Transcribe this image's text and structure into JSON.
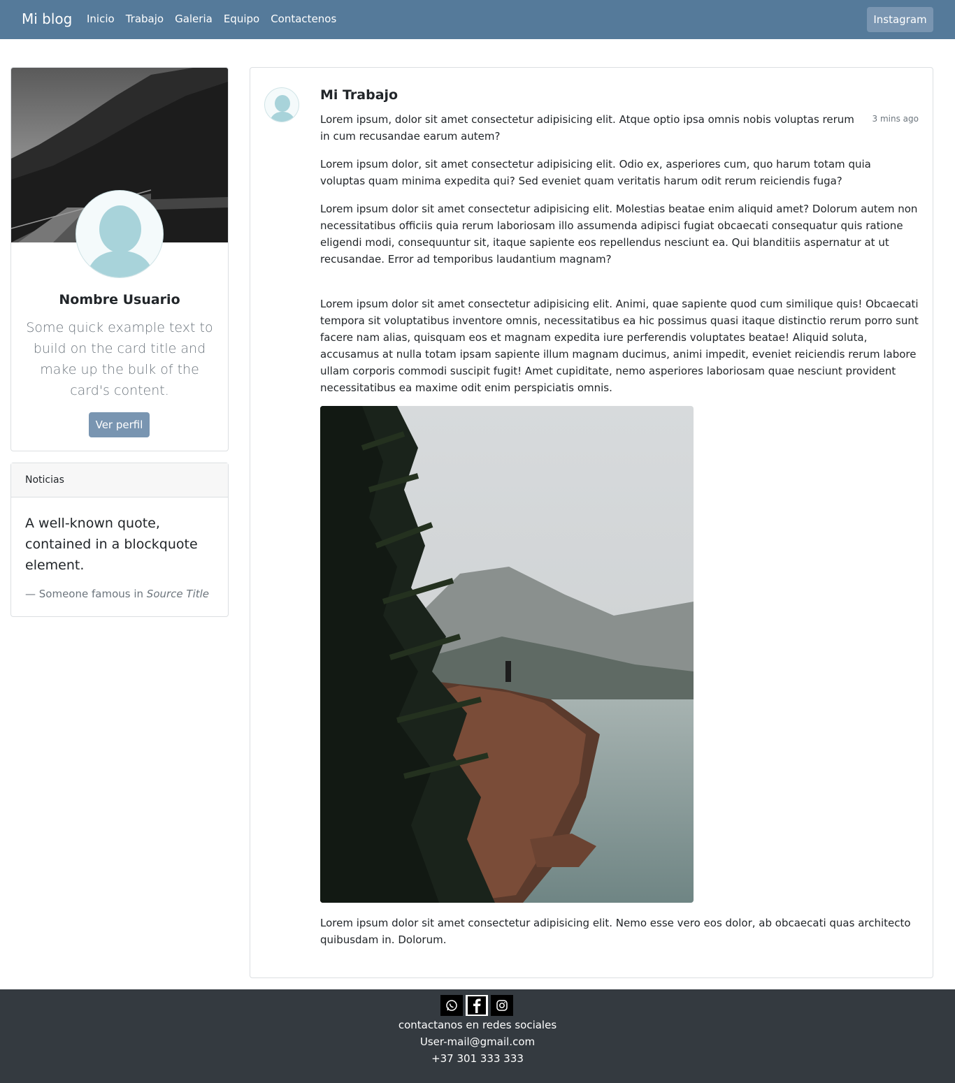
{
  "navbar": {
    "brand": "Mi blog",
    "links": [
      "Inicio",
      "Trabajo",
      "Galeria",
      "Equipo",
      "Contactenos"
    ],
    "button": "Instagram"
  },
  "profile": {
    "name": "Nombre Usuario",
    "text": "Some quick example text to build on the card title and make up the bulk of the card's content.",
    "button": "Ver perfil"
  },
  "news": {
    "header": "Noticias",
    "quote": "A well-known quote, contained in a blockquote element.",
    "footer_prefix": "— Someone famous in",
    "source": "Source Title"
  },
  "post": {
    "title": "Mi Trabajo",
    "time": "3 mins ago",
    "paragraphs": [
      "Lorem ipsum, dolor sit amet consectetur adipisicing elit. Atque optio ipsa omnis nobis voluptas rerum in cum recusandae earum autem?",
      "Lorem ipsum dolor, sit amet consectetur adipisicing elit. Odio ex, asperiores cum, quo harum totam quia voluptas quam minima expedita qui? Sed eveniet quam veritatis harum odit rerum reiciendis fuga?",
      "Lorem ipsum dolor sit amet consectetur adipisicing elit. Molestias beatae enim aliquid amet? Dolorum autem non necessitatibus officiis quia rerum laboriosam illo assumenda adipisci fugiat obcaecati consequatur quis ratione eligendi modi, consequuntur sit, itaque sapiente eos repellendus nesciunt ea. Qui blanditiis aspernatur at ut recusandae. Error ad temporibus laudantium magnam?",
      "Lorem ipsum dolor sit amet consectetur adipisicing elit. Animi, quae sapiente quod cum similique quis! Obcaecati tempora sit voluptatibus inventore omnis, necessitatibus ea hic possimus quasi itaque distinctio rerum porro sunt facere nam alias, quisquam eos et magnam expedita iure perferendis voluptates beatae! Aliquid soluta, accusamus at nulla totam ipsam sapiente illum magnam ducimus, animi impedit, eveniet reiciendis rerum labore ullam corporis commodi suscipit fugit! Amet cupiditate, nemo asperiores laboriosam quae nesciunt provident necessitatibus ea maxime odit enim perspiciatis omnis.",
      "Lorem ipsum dolor sit amet consectetur adipisicing elit. Nemo esse vero eos dolor, ab obcaecati quas architecto quibusdam in. Dolorum."
    ]
  },
  "footer": {
    "icons": [
      "whatsapp-icon",
      "facebook-icon",
      "instagram-icon"
    ],
    "social_text": "contactanos en redes sociales",
    "email": "User-mail@gmail.com",
    "phone": "+37 301 333 333"
  },
  "colors": {
    "navbar": "#557a9a",
    "button": "#7995b1",
    "footer": "#343a40"
  }
}
